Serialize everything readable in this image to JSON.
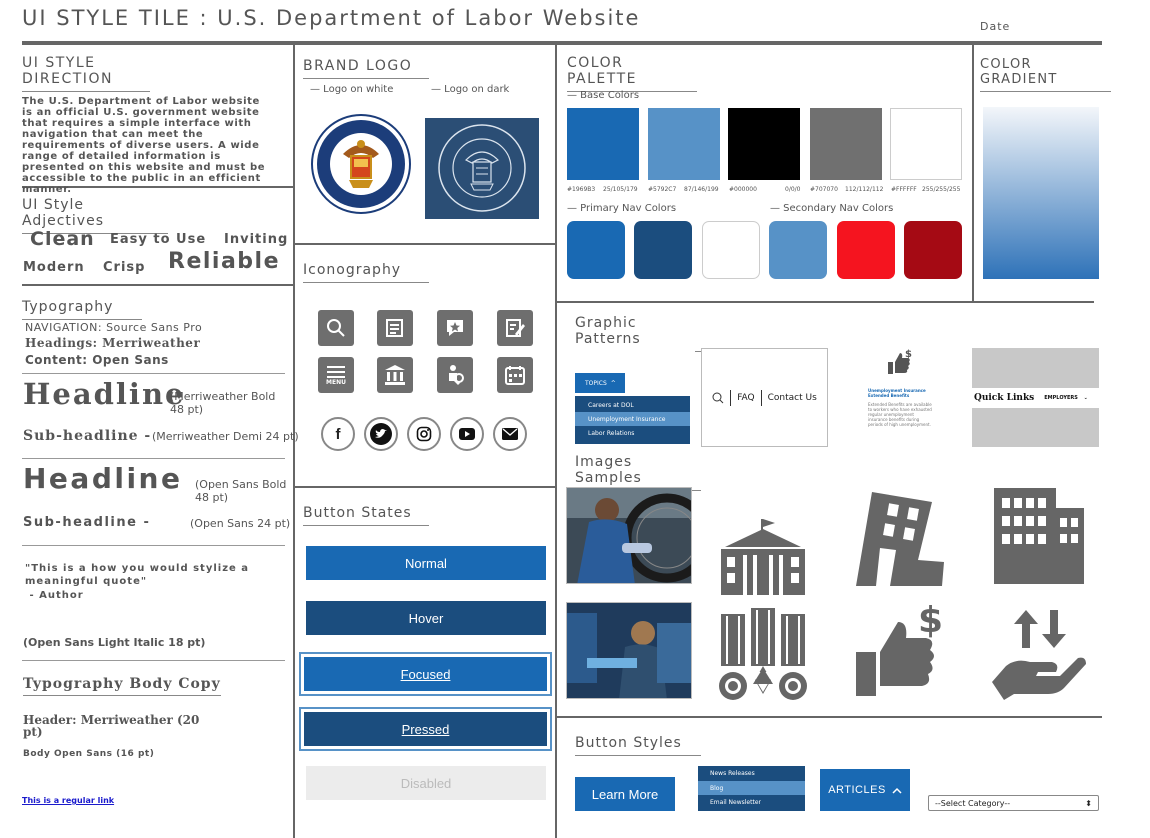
{
  "title": "UI STYLE TILE : U.S. Department of Labor Website",
  "date_label": "Date",
  "style_direction": {
    "heading": "UI STYLE DIRECTION",
    "text": "The U.S. Department of Labor website is an official U.S. government website that requires a simple interface with navigation that can meet the requirements of diverse users. A wide range of detailed information is presented on this website and must be accessible to the public in an efficient manner."
  },
  "adjectives": {
    "heading": "UI Style Adjectives",
    "words": [
      "Clean",
      "Easy to Use",
      "Inviting",
      "Modern",
      "Crisp",
      "Reliable"
    ]
  },
  "typography": {
    "heading": "Typography",
    "nav": "NAVIGATION: Source Sans Pro",
    "headings": "Headings: Merriweather",
    "content": "Content: Open Sans",
    "headline1": "Headline",
    "headline1_note": "(Merriweather Bold 48 pt)",
    "sub1": "Sub-headline  -",
    "sub1_note": "(Merriweather Demi 24 pt)",
    "headline2": "Headline",
    "headline2_note": "(Open Sans Bold 48 pt)",
    "sub2": "Sub-headline -",
    "sub2_note": "(Open Sans 24 pt)",
    "quote": "\"This is a how you would stylize a meaningful quote\"",
    "author": " - Author",
    "quote_note": "(Open Sans Light Italic 18 pt)",
    "body_heading": "Typography Body Copy",
    "body_header": "Header: Merriweather (20 pt)",
    "body_font": "Body Open Sans (16 pt)",
    "link": "This is a regular link"
  },
  "brand": {
    "heading": "BRAND LOGO",
    "on_white": "— Logo on white",
    "on_dark": "— Logo on dark",
    "seal_text": "DEPARTMENT OF LABOR",
    "seal_text_bottom": "UNITED STATES OF AMERICA"
  },
  "iconography": {
    "heading": "Iconography",
    "menu_label": "MENU"
  },
  "button_states": {
    "heading": "Button States",
    "normal": "Normal",
    "hover": "Hover",
    "focused": "Focused",
    "pressed": "Pressed",
    "disabled": "Disabled"
  },
  "palette": {
    "heading": "COLOR PALETTE",
    "base_label": "— Base Colors",
    "primary_label": "— Primary Nav Colors",
    "secondary_label": "— Secondary Nav Colors",
    "base": [
      {
        "hex": "#1969B3",
        "rgb": "25/105/179",
        "color": "#1969B3"
      },
      {
        "hex": "#5792C7",
        "rgb": "87/146/199",
        "color": "#5792C7"
      },
      {
        "hex": "#000000",
        "rgb": "0/0/0",
        "color": "#000000"
      },
      {
        "hex": "#707070",
        "rgb": "112/112/112",
        "color": "#707070"
      },
      {
        "hex": "#FFFFFF",
        "rgb": "255/255/255",
        "color": "#FFFFFF"
      }
    ],
    "primary_nav": [
      "#1969B3",
      "#1B4D7E",
      "#FFFFFF"
    ],
    "secondary_nav": [
      "#5792C7",
      "#F5141F",
      "#A50A14"
    ]
  },
  "gradient": {
    "heading": "COLOR GRADIENT",
    "from": "#F3F6FA",
    "to": "#2E72B8"
  },
  "patterns": {
    "heading": "Graphic Patterns",
    "topics": "TOPICS",
    "items": [
      "Careers at DOL",
      "Unemployment Insurance",
      "Labor Relations"
    ],
    "faq": "FAQ",
    "contact": "Contact Us",
    "ui_title": "Unemployment Insurance Extended Benefits",
    "ui_text": "Extended Benefits are available to workers who have exhausted regular unemployment insurance benefits during periods of high unemployment.",
    "quick_links": "Quick Links",
    "employers": "EMPLOYERS"
  },
  "images": {
    "heading": "Images Samples"
  },
  "button_styles": {
    "heading": "Button Styles",
    "learn_more": "Learn More",
    "dropdown_items": [
      "News Releases",
      "Blog",
      "Email Newsletter"
    ],
    "articles": "ARTICLES",
    "select_value": "--Select Category--"
  }
}
